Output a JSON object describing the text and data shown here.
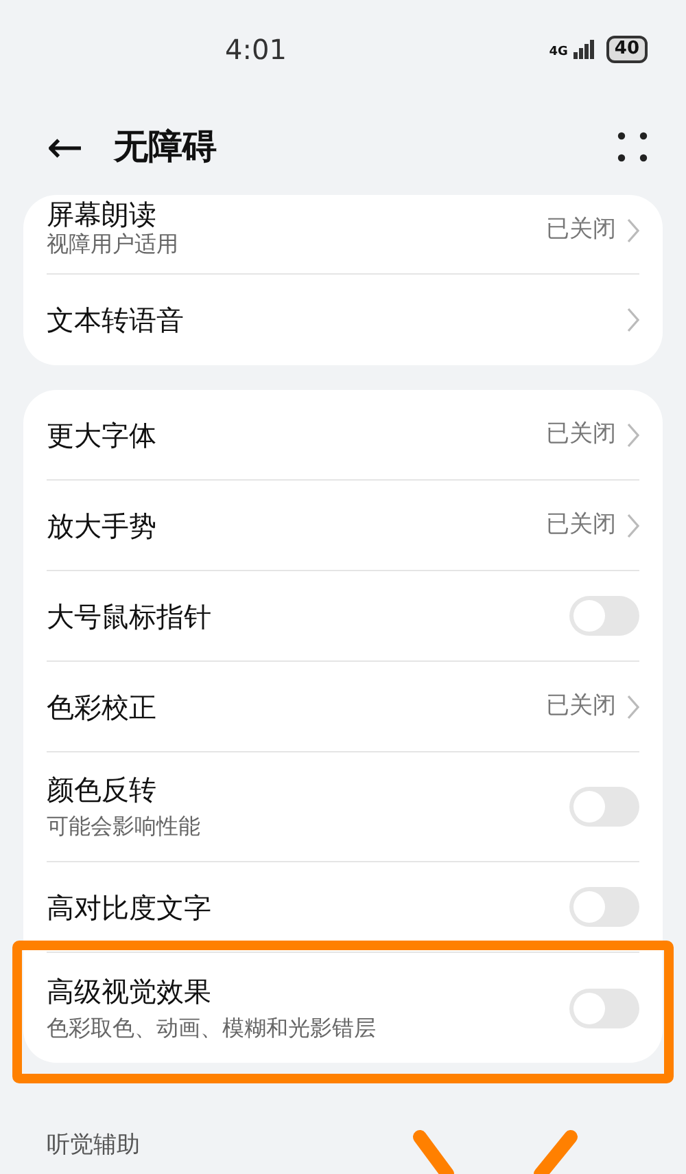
{
  "status_bar": {
    "time": "4:01",
    "network": "4G",
    "battery": "40"
  },
  "header": {
    "back": "←",
    "title": "无障碍"
  },
  "groups": [
    {
      "items": [
        {
          "kind": "link",
          "title": "屏幕朗读",
          "subtitle": "视障用户适用",
          "value": "已关闭",
          "highlighted": false
        },
        {
          "kind": "link",
          "title": "文本转语音",
          "highlighted": false
        }
      ]
    },
    {
      "items": [
        {
          "kind": "link",
          "title": "更大字体",
          "value": "已关闭",
          "highlighted": false
        },
        {
          "kind": "link",
          "title": "放大手势",
          "value": "已关闭",
          "highlighted": false
        },
        {
          "kind": "toggle",
          "title": "大号鼠标指针",
          "on": false,
          "highlighted": false
        },
        {
          "kind": "link",
          "title": "色彩校正",
          "value": "已关闭",
          "highlighted": false
        },
        {
          "kind": "toggle",
          "title": "颜色反转",
          "subtitle": "可能会影响性能",
          "on": false,
          "highlighted": false
        },
        {
          "kind": "toggle",
          "title": "高对比度文字",
          "on": false,
          "highlighted": false
        },
        {
          "kind": "toggle",
          "title": "高级视觉效果",
          "subtitle": "色彩取色、动画、模糊和光影错层",
          "on": false,
          "highlighted": true
        }
      ]
    }
  ],
  "section_label": "听觉辅助"
}
